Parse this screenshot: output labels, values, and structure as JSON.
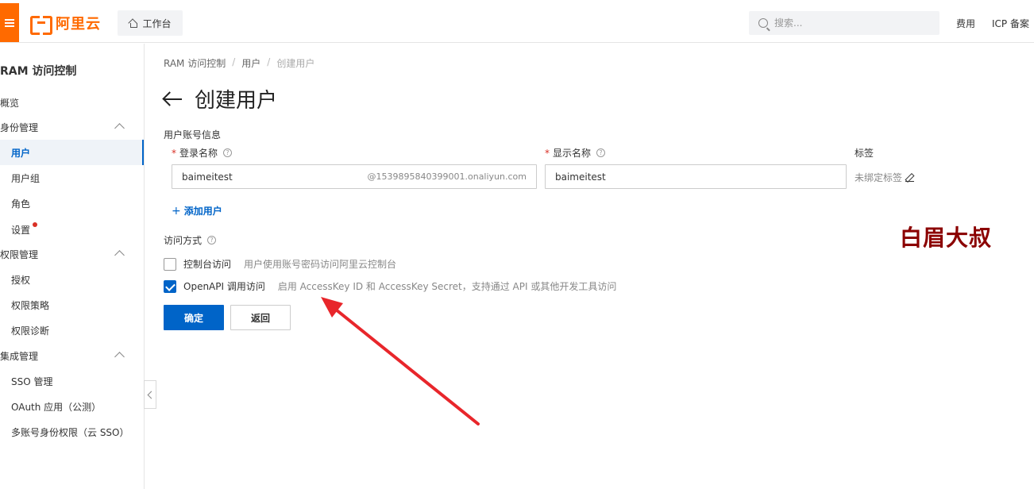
{
  "topbar": {
    "logo_text": "阿里云",
    "workbench_label": "工作台",
    "search_placeholder": "搜索...",
    "links": [
      "费用",
      "ICP 备案"
    ]
  },
  "sidebar": {
    "title": "RAM 访问控制",
    "overview": "概览",
    "identity_group": "身份管理",
    "identity_items": [
      "用户",
      "用户组",
      "角色",
      "设置"
    ],
    "permission_group": "权限管理",
    "permission_items": [
      "授权",
      "权限策略",
      "权限诊断"
    ],
    "integration_group": "集成管理",
    "integration_items": [
      "SSO 管理",
      "OAuth 应用（公测）",
      "多账号身份权限（云 SSO）"
    ]
  },
  "breadcrumb": [
    "RAM 访问控制",
    "用户",
    "创建用户"
  ],
  "page_title": "创建用户",
  "form": {
    "section_title": "用户账号信息",
    "login_name_label": "登录名称",
    "login_name_value": "baimeitest",
    "login_name_suffix": "@1539895840399001.onaliyun.com",
    "display_name_label": "显示名称",
    "display_name_value": "baimeitest",
    "tag_label": "标签",
    "tag_value": "未绑定标签",
    "add_user": "添加用户",
    "access_title": "访问方式",
    "console_access_label": "控制台访问",
    "console_access_desc": "用户使用账号密码访问阿里云控制台",
    "console_access_checked": false,
    "api_access_label": "OpenAPI 调用访问",
    "api_access_desc": "启用 AccessKey ID 和 AccessKey Secret，支持通过 API 或其他开发工具访问",
    "api_access_checked": true,
    "confirm_button": "确定",
    "back_button": "返回"
  },
  "watermark": "白眉大叔",
  "colors": {
    "brand_orange": "#ff6a00",
    "primary_blue": "#0064c8",
    "required_red": "#d93026",
    "annotation_red": "#e8262b",
    "watermark_red": "#8b0000"
  }
}
